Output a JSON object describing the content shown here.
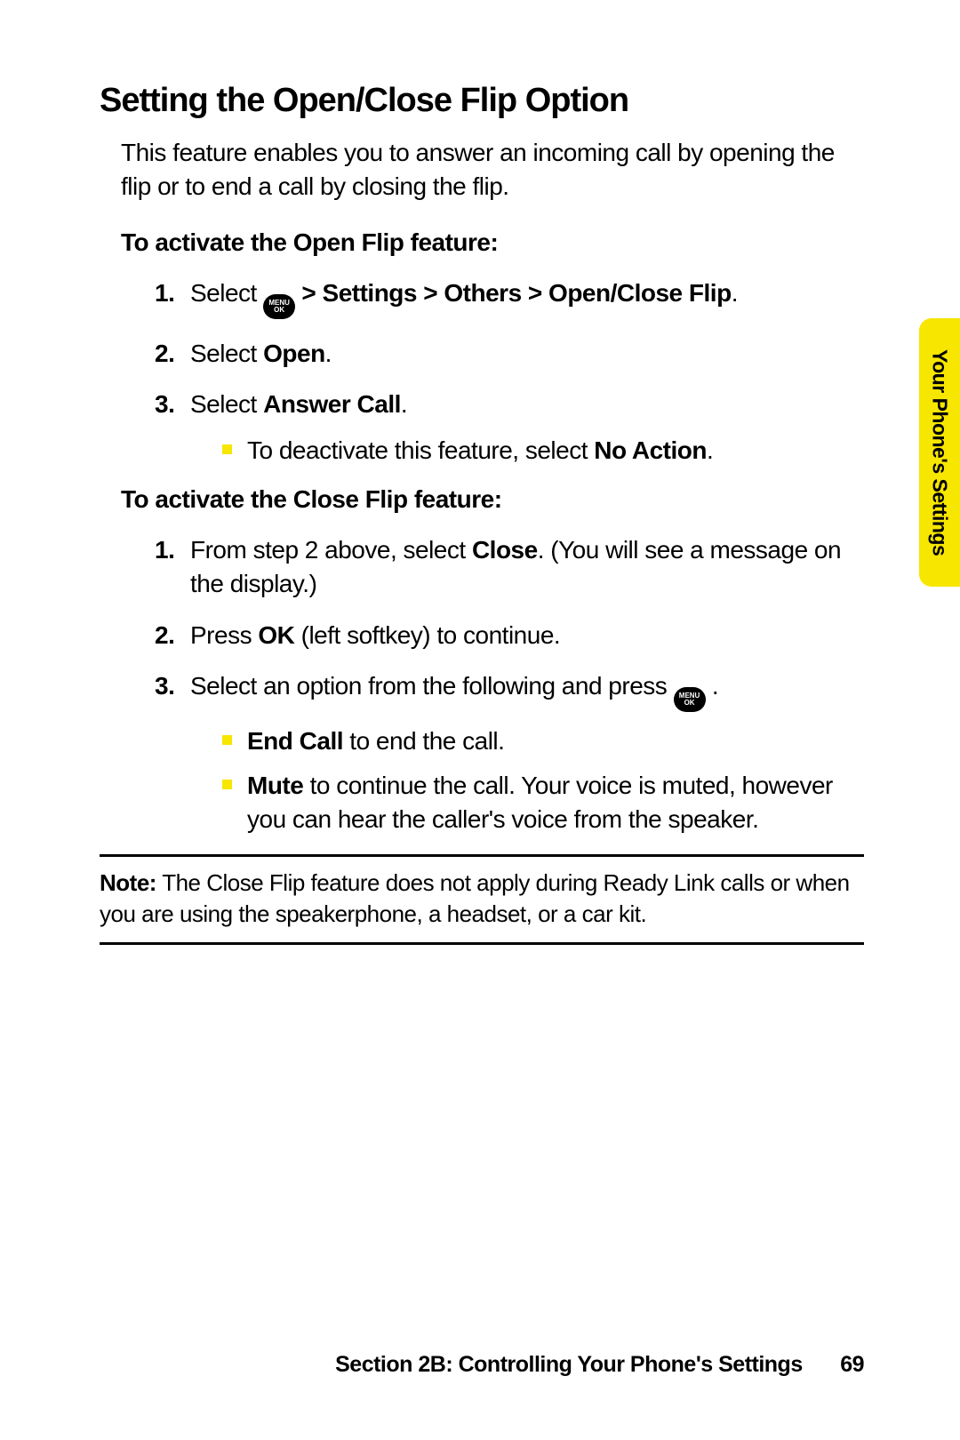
{
  "heading": "Setting the Open/Close Flip Option",
  "intro": "This feature enables you to answer an incoming call by opening the flip or to end a call by closing the flip.",
  "menuIconTop": "MENU",
  "menuIconBottom": "OK",
  "sectionA": {
    "title": "To activate the Open Flip feature:",
    "step1_a": "Select ",
    "step1_b": " > Settings > Others > Open/Close Flip",
    "step1_c": ".",
    "step2_a": "Select ",
    "step2_b": "Open",
    "step2_c": ".",
    "step3_a": "Select ",
    "step3_b": "Answer Call",
    "step3_c": ".",
    "step3_sub_a": "To deactivate this feature, select ",
    "step3_sub_b": "No Action",
    "step3_sub_c": "."
  },
  "sectionB": {
    "title": "To activate the Close Flip feature:",
    "step1_a": "From step 2 above, select ",
    "step1_b": "Close",
    "step1_c": ". (You will see a message on the display.)",
    "step2_a": "Press ",
    "step2_b": "OK",
    "step2_c": " (left softkey) to continue.",
    "step3_a": "Select an option from the following and press ",
    "step3_c": " .",
    "step3_sub1_a": "End Call",
    "step3_sub1_b": " to end the call.",
    "step3_sub2_a": "Mute",
    "step3_sub2_b": " to continue the call. Your voice is muted, however you can hear the caller's voice from the speaker."
  },
  "note_label": "Note:",
  "note_body": " The Close Flip feature does not apply during Ready Link calls or when you are using the speakerphone, a headset, or a car kit.",
  "side_tab": "Your Phone's Settings",
  "footer_text": "Section 2B: Controlling Your Phone's Settings",
  "page_number": "69"
}
